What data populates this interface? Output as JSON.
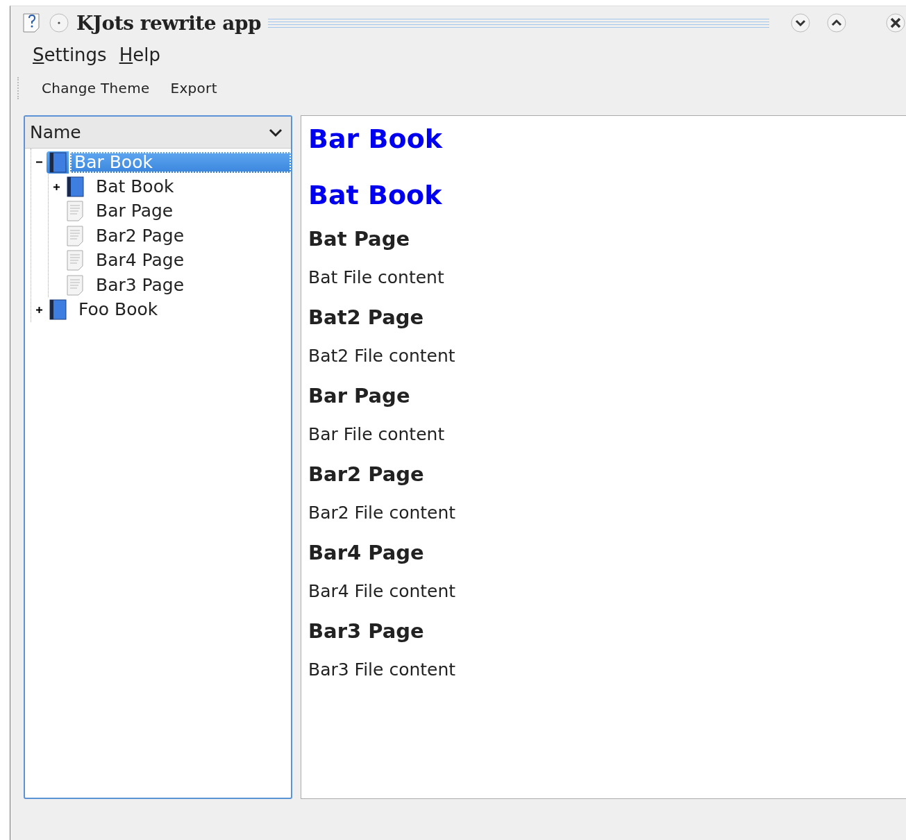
{
  "window": {
    "title": "KJots rewrite app"
  },
  "menu": [
    {
      "label": "Settings"
    },
    {
      "label": "Help"
    }
  ],
  "toolbar": [
    {
      "label": "Change Theme"
    },
    {
      "label": "Export"
    }
  ],
  "tree": {
    "header": "Name",
    "items": [
      {
        "kind": "book",
        "label": "Bar Book",
        "expanded": true,
        "selected": true,
        "children": [
          {
            "kind": "book",
            "label": "Bat Book",
            "expanded": false,
            "selected": false
          },
          {
            "kind": "page",
            "label": "Bar Page",
            "selected": false
          },
          {
            "kind": "page",
            "label": "Bar2 Page",
            "selected": false
          },
          {
            "kind": "page",
            "label": "Bar4 Page",
            "selected": false
          },
          {
            "kind": "page",
            "label": "Bar3 Page",
            "selected": false
          }
        ]
      },
      {
        "kind": "book",
        "label": "Foo Book",
        "expanded": false,
        "selected": false
      }
    ]
  },
  "content": [
    {
      "kind": "book",
      "text": "Bar Book"
    },
    {
      "kind": "book",
      "text": "Bat Book"
    },
    {
      "kind": "page",
      "text": "Bat Page"
    },
    {
      "kind": "body",
      "text": "Bat File content"
    },
    {
      "kind": "page",
      "text": "Bat2 Page"
    },
    {
      "kind": "body",
      "text": "Bat2 File content"
    },
    {
      "kind": "page",
      "text": "Bar Page"
    },
    {
      "kind": "body",
      "text": "Bar File content"
    },
    {
      "kind": "page",
      "text": "Bar2 Page"
    },
    {
      "kind": "body",
      "text": "Bar2 File content"
    },
    {
      "kind": "page",
      "text": "Bar4 Page"
    },
    {
      "kind": "body",
      "text": "Bar4 File content"
    },
    {
      "kind": "page",
      "text": "Bar3 Page"
    },
    {
      "kind": "body",
      "text": "Bar3 File content"
    }
  ]
}
